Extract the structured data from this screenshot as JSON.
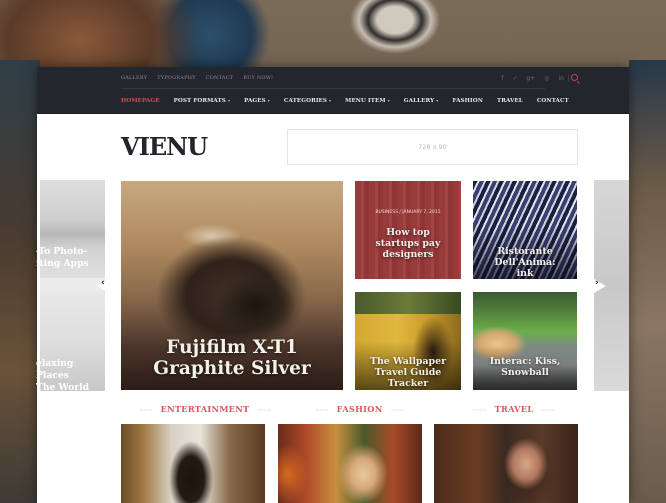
{
  "topbar": {
    "links": [
      "GALLERY",
      "TYPOGRAPHY",
      "CONTACT",
      "BUY NOW!"
    ],
    "social": [
      {
        "icon": "facebook-icon",
        "glyph": "f"
      },
      {
        "icon": "twitter-icon",
        "glyph": "✓"
      },
      {
        "icon": "google-plus-icon",
        "glyph": "g+"
      },
      {
        "icon": "pinterest-icon",
        "glyph": "◎"
      },
      {
        "icon": "linkedin-icon",
        "glyph": "in"
      }
    ]
  },
  "nav": {
    "items": [
      {
        "label": "HOMEPAGE",
        "active": true,
        "dropdown": false
      },
      {
        "label": "POST FORMATS",
        "active": false,
        "dropdown": true
      },
      {
        "label": "PAGES",
        "active": false,
        "dropdown": true
      },
      {
        "label": "CATEGORIES",
        "active": false,
        "dropdown": true
      },
      {
        "label": "MENU ITEM",
        "active": false,
        "dropdown": true
      },
      {
        "label": "GALLERY",
        "active": false,
        "dropdown": true
      },
      {
        "label": "FASHION",
        "active": false,
        "dropdown": false
      },
      {
        "label": "TRAVEL",
        "active": false,
        "dropdown": false
      },
      {
        "label": "CONTACT",
        "active": false,
        "dropdown": false
      }
    ],
    "caret": "▾"
  },
  "header": {
    "logo": "VIENU",
    "ad_text": "728 x 90"
  },
  "slider": {
    "prev_partial": [
      "-To Photo-\niting Apps",
      "elaxing Places\nThe World"
    ],
    "main": {
      "title": "Fujifilm X-T1 Graphite Silver"
    },
    "cards": [
      {
        "meta": "BUSINESS / JANUARY 7, 2015",
        "title": "How top startups pay designers"
      },
      {
        "title": "Ristorante Dell'Anima: ink"
      },
      {
        "title": "The Wallpaper Travel Guide Tracker"
      },
      {
        "title": "Interac: Kiss, Snowball"
      }
    ],
    "prev_glyph": "‹",
    "next_glyph": "›"
  },
  "sections": [
    {
      "label": "ENTERTAINMENT"
    },
    {
      "label": "FASHION"
    },
    {
      "label": "TRAVEL"
    }
  ],
  "colors": {
    "accent": "#d9575c",
    "dark_bar": "#24262d"
  }
}
